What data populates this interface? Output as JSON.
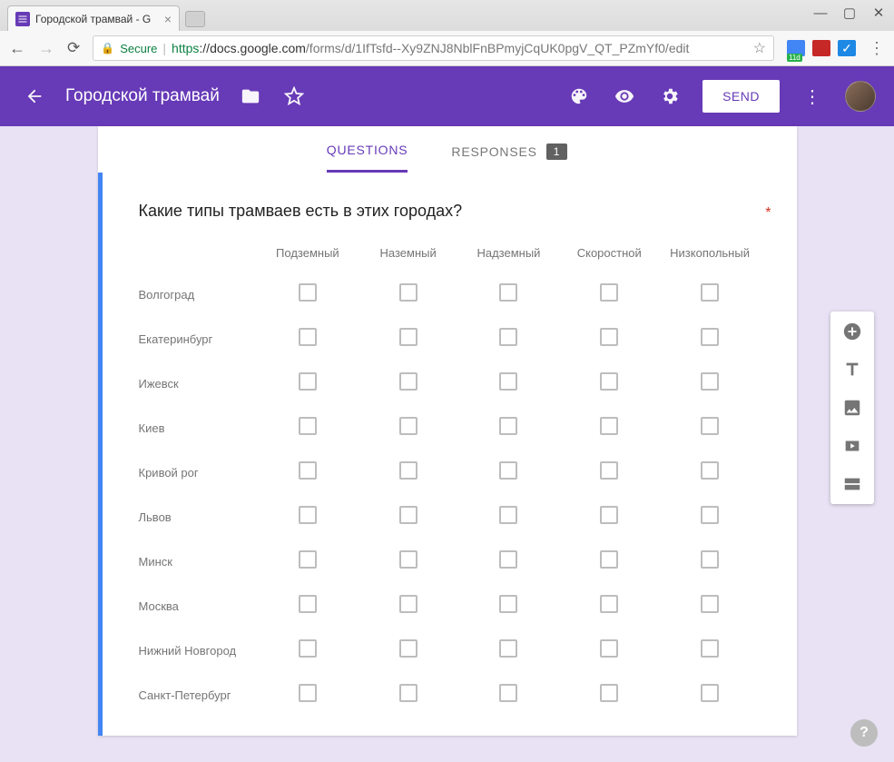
{
  "browser": {
    "tab_title": "Городской трамвай - G",
    "secure_label": "Secure",
    "url_scheme": "https",
    "url_host": "://docs.google.com",
    "url_path": "/forms/d/1IfTsfd--Xy9ZNJ8NblFnBPmyjCqUK0pgV_QT_PZmYf0/edit"
  },
  "header": {
    "form_title": "Городской трамвай",
    "send_label": "SEND"
  },
  "tabs": {
    "questions": "QUESTIONS",
    "responses": "RESPONSES",
    "responses_count": "1"
  },
  "question": {
    "title": "Какие типы трамваев есть в этих городах?",
    "required_marker": "*",
    "columns": [
      "Подземный",
      "Наземный",
      "Надземный",
      "Скоростной",
      "Низкопольный"
    ],
    "rows": [
      "Волгоград",
      "Екатеринбург",
      "Ижевск",
      "Киев",
      "Кривой рог",
      "Львов",
      "Минск",
      "Москва",
      "Нижний Новгород",
      "Санкт-Петербург"
    ]
  },
  "help": "?"
}
